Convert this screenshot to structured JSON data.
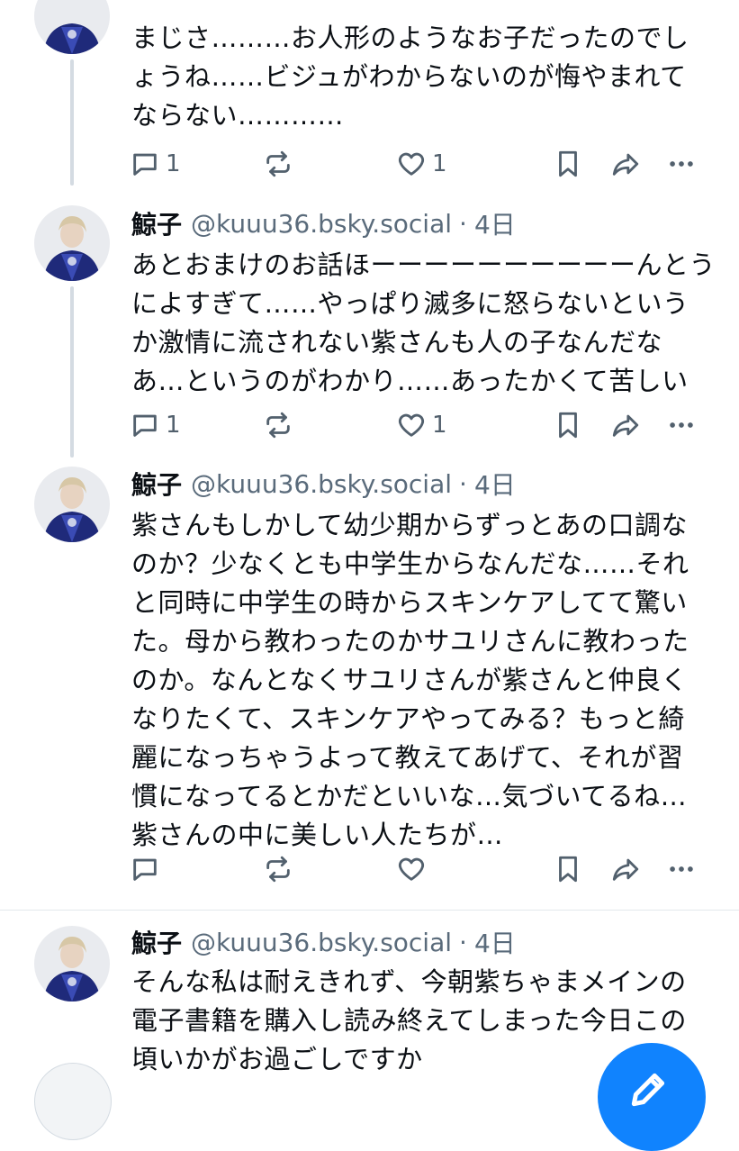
{
  "colors": {
    "accent": "#1083fe",
    "text": "#0b0f14",
    "muted": "#5a6b7b",
    "thread_line": "#d4dbe2"
  },
  "posts": [
    {
      "author": "",
      "handle": "",
      "time": "",
      "lines": [
        "まじさ………お人形のようなお子だったのでし",
        "ょうね……ビジュがわからないのが悔やまれて",
        "ならない…………"
      ],
      "reply_count": "1",
      "repost_count": "",
      "like_count": "1"
    },
    {
      "author": "鯨子",
      "handle": "@kuuu36.bsky.social",
      "time": "4日",
      "lines": [
        "あとおまけのお話ほーーーーーーーーーーんとう",
        "によすぎて……やっぱり滅多に怒らないという",
        "か激情に流されない紫さんも人の子なんだな",
        "あ…というのがわかり……あったかくて苦しい"
      ],
      "reply_count": "1",
      "repost_count": "",
      "like_count": "1"
    },
    {
      "author": "鯨子",
      "handle": "@kuuu36.bsky.social",
      "time": "4日",
      "lines": [
        "紫さんもしかして幼少期からずっとあの口調な",
        "のか？少なくとも中学生からなんだな……それ",
        "と同時に中学生の時からスキンケアしてて驚い",
        "た。母から教わったのかサユリさんに教わった",
        "のか。なんとなくサユリさんが紫さんと仲良く",
        "なりたくて、スキンケアやってみる？もっと綺",
        "麗になっちゃうよって教えてあげて、それが習",
        "慣になってるとかだといいな…気づいてるね…",
        "紫さんの中に美しい人たちが…"
      ],
      "reply_count": "",
      "repost_count": "",
      "like_count": ""
    },
    {
      "author": "鯨子",
      "handle": "@kuuu36.bsky.social",
      "time": "4日",
      "lines": [
        "そんな私は耐えきれず、今朝紫ちゃまメインの",
        "電子書籍を購入し読み終えてしまった今日この",
        "頃いかがお過ごしですか"
      ]
    }
  ],
  "icons": {
    "reply": "speech-bubble-icon",
    "repost": "repost-arrows-icon",
    "like": "heart-icon",
    "bookmark": "bookmark-icon",
    "share": "share-arrow-icon",
    "more": "more-dots-icon",
    "compose": "compose-pencil-icon"
  }
}
